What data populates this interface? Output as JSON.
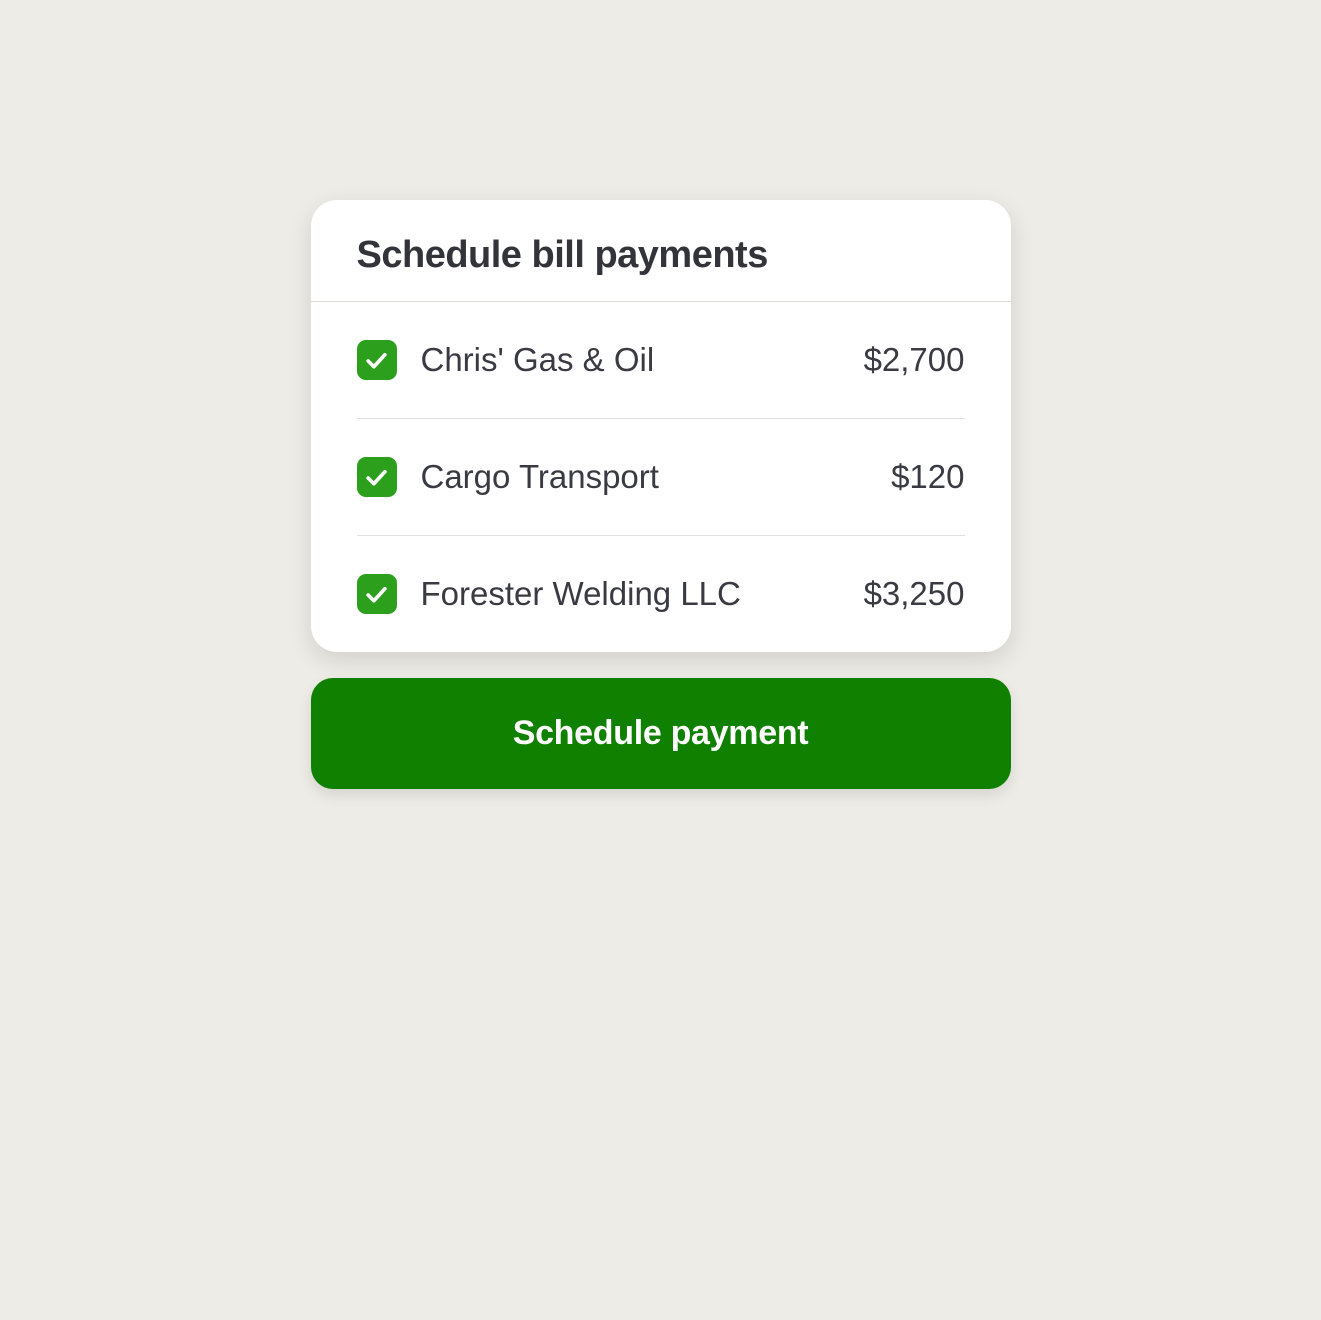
{
  "card": {
    "title": "Schedule bill payments",
    "bills": [
      {
        "checked": true,
        "vendor": "Chris' Gas & Oil",
        "amount": "$2,700"
      },
      {
        "checked": true,
        "vendor": "Cargo Transport",
        "amount": "$120"
      },
      {
        "checked": true,
        "vendor": "Forester Welding LLC",
        "amount": "$3,250"
      }
    ]
  },
  "button": {
    "label": "Schedule payment"
  },
  "colors": {
    "accent": "#2ca01c",
    "buttonBg": "#108000"
  }
}
